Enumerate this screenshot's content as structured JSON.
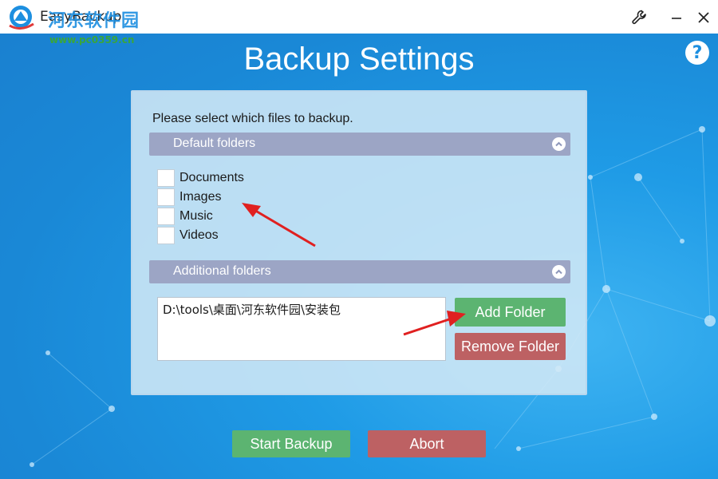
{
  "window": {
    "title": "EasyBackup",
    "watermark_text": "河东软件园",
    "watermark_url": "www.pc0359.cn"
  },
  "titlebar": {
    "settings_icon": "wrench-icon",
    "minimize_icon": "minimize-icon",
    "close_icon": "close-icon"
  },
  "header": {
    "title": "Backup Settings",
    "help_label": "?"
  },
  "panel": {
    "instruction": "Please select which files to backup.",
    "default_section": {
      "label": "Default folders",
      "toggle_icon": "chevron-up-icon",
      "items": [
        {
          "label": "Documents",
          "checked": false
        },
        {
          "label": "Images",
          "checked": false
        },
        {
          "label": "Music",
          "checked": false
        },
        {
          "label": "Videos",
          "checked": false
        }
      ]
    },
    "additional_section": {
      "label": "Additional folders",
      "toggle_icon": "chevron-up-icon",
      "folders": [
        "D:\\tools\\桌面\\河东软件园\\安装包"
      ]
    },
    "add_folder_label": "Add Folder",
    "remove_folder_label": "Remove Folder"
  },
  "footer": {
    "start_label": "Start Backup",
    "abort_label": "Abort"
  },
  "colors": {
    "background": "#1f9be6",
    "section_bar": "#9ca5c5",
    "button_green": "#5cb471",
    "button_red": "#bd6163",
    "annotation_arrow": "#e02020"
  }
}
